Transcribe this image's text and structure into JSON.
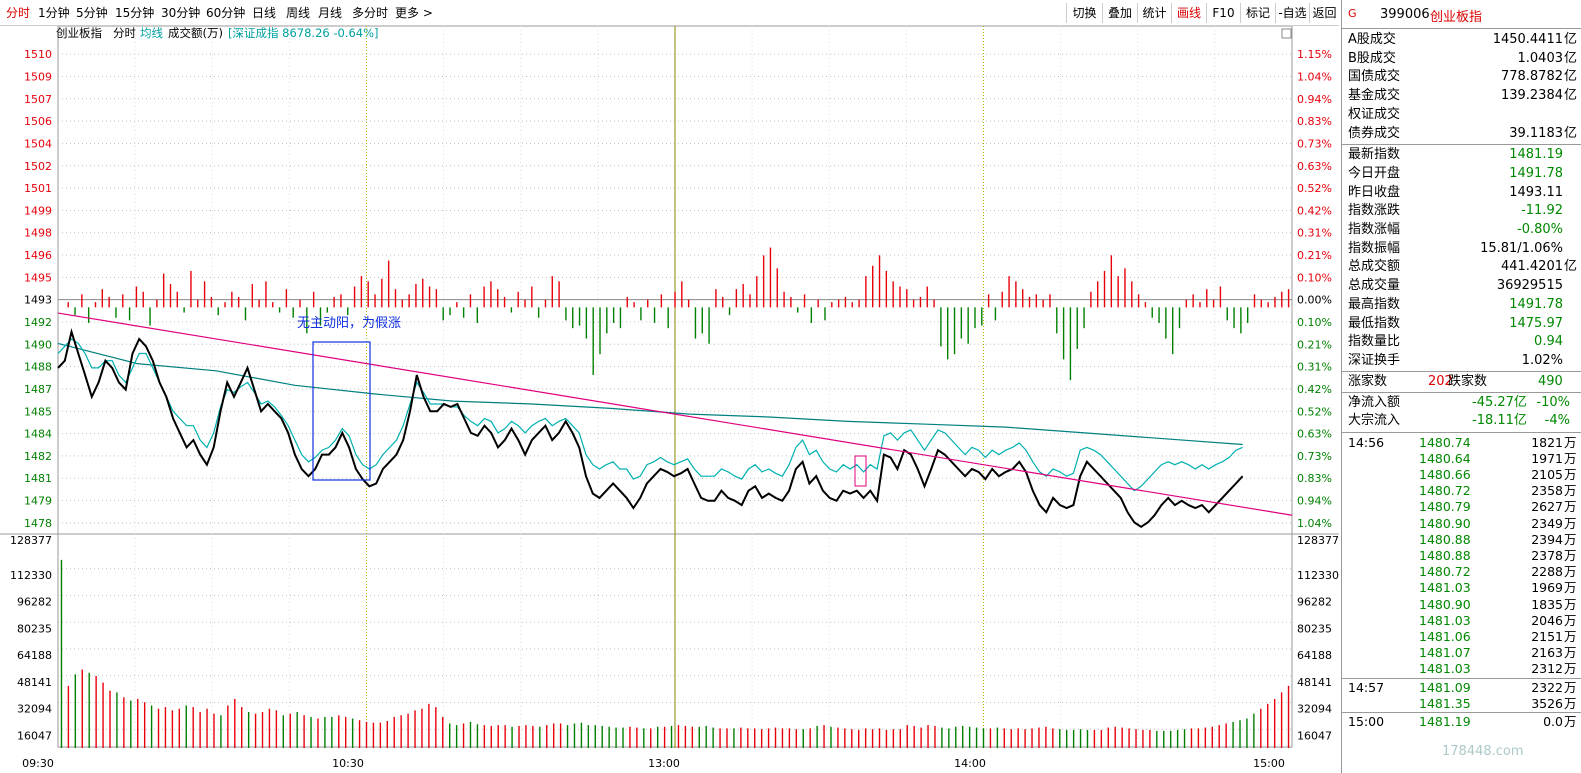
{
  "toolbar": {
    "periods": [
      "分时",
      "1分钟",
      "5分钟",
      "15分钟",
      "30分钟",
      "60分钟",
      "日线",
      "周线",
      "月线",
      "多分时",
      "更多 >"
    ],
    "actions": [
      "切换",
      "叠加",
      "统计",
      "画线",
      "F10",
      "标记",
      "-自选",
      "返回"
    ]
  },
  "chart": {
    "header": {
      "name": "创业板指",
      "mode": "分时",
      "avg": "均线",
      "vol": "成交额(万)",
      "ref": "[深证成指 8678.26 -0.64%]"
    },
    "annotation": "无主动阳，为假涨",
    "price_labels": [
      "1510",
      "1509",
      "1507",
      "1506",
      "1504",
      "1502",
      "1501",
      "1499",
      "1498",
      "1496",
      "1495",
      "1493",
      "1492",
      "1490",
      "1488",
      "1487",
      "1485",
      "1484",
      "1482",
      "1481",
      "1479",
      "1478"
    ],
    "pct_labels": [
      "1.15%",
      "1.04%",
      "0.94%",
      "0.83%",
      "0.73%",
      "0.63%",
      "0.52%",
      "0.42%",
      "0.31%",
      "0.21%",
      "0.10%",
      "0.00%",
      "0.10%",
      "0.21%",
      "0.31%",
      "0.42%",
      "0.52%",
      "0.63%",
      "0.73%",
      "0.83%",
      "0.94%",
      "1.04%"
    ],
    "vol_labels": [
      "128377",
      "112330",
      "96282",
      "80235",
      "64188",
      "48141",
      "32094",
      "16047"
    ],
    "time_labels": [
      "09:30",
      "10:30",
      "13:00",
      "14:00",
      "15:00"
    ],
    "colors": {
      "up": "#e8000b",
      "down": "#008000",
      "price": "#000000",
      "avg": "#00b0b0",
      "ma": "#008080",
      "trend": "#e0007f",
      "box": "#1030e0",
      "grid": "#bfbfbf",
      "vgrid": "#8a8a00"
    }
  },
  "chart_data": {
    "type": "line",
    "title": "创业板指 分时",
    "prev_close": 1493.11,
    "ylim": [
      1477,
      1511
    ],
    "price": [
      1488.5,
      1489,
      1491,
      1489.5,
      1488.0,
      1486.5,
      1487.5,
      1489.0,
      1488.5,
      1487.5,
      1487.0,
      1489.5,
      1490.5,
      1490.0,
      1489.0,
      1487.5,
      1486.5,
      1485.0,
      1484.0,
      1483.0,
      1483.5,
      1482.5,
      1481.8,
      1483.0,
      1485.5,
      1487.5,
      1486.5,
      1487.5,
      1488.5,
      1487.0,
      1485.5,
      1486.0,
      1485.5,
      1485.0,
      1484.0,
      1482.5,
      1481.5,
      1481.0,
      1481.5,
      1482.5,
      1482.5,
      1483.0,
      1484.0,
      1483.0,
      1481.5,
      1480.8,
      1480.3,
      1480.5,
      1481.5,
      1482.0,
      1482.5,
      1483.5,
      1485.5,
      1488.0,
      1486.5,
      1485.5,
      1485.5,
      1486.0,
      1485.8,
      1486.0,
      1485.0,
      1484.0,
      1483.8,
      1484.5,
      1484.0,
      1483.0,
      1483.5,
      1484.3,
      1483.5,
      1482.5,
      1483.5,
      1484.0,
      1484.5,
      1483.5,
      1484.0,
      1484.8,
      1484.0,
      1483.0,
      1481.0,
      1479.8,
      1479.5,
      1480.0,
      1480.5,
      1480.0,
      1479.5,
      1478.8,
      1479.5,
      1480.5,
      1481.0,
      1481.5,
      1481.3,
      1481.0,
      1481.2,
      1481.5,
      1480.5,
      1479.5,
      1479.3,
      1479.3,
      1480.0,
      1479.5,
      1479.3,
      1479.0,
      1480.0,
      1480.3,
      1479.5,
      1479.8,
      1479.5,
      1479.3,
      1480.0,
      1481.5,
      1482.0,
      1480.5,
      1481.0,
      1480.0,
      1479.5,
      1479.3,
      1480.0,
      1479.8,
      1480.0,
      1479.5,
      1480.0,
      1479.3,
      1482.5,
      1482.3,
      1481.5,
      1482.8,
      1482.5,
      1481.5,
      1480.3,
      1481.5,
      1482.8,
      1482.5,
      1482.0,
      1481.5,
      1481.0,
      1481.5,
      1481.3,
      1480.8,
      1481.5,
      1481.0,
      1481.3,
      1481.5,
      1482.0,
      1481.3,
      1480.0,
      1479.0,
      1478.5,
      1479.5,
      1479.0,
      1478.8,
      1479.0,
      1481.0,
      1482.0,
      1481.5,
      1481.0,
      1480.5,
      1480.0,
      1479.5,
      1478.5,
      1477.8,
      1477.5,
      1477.8,
      1478.3,
      1479.0,
      1479.5,
      1479.0,
      1479.3,
      1479.0,
      1478.8,
      1479.0,
      1478.5,
      1479.0,
      1479.5,
      1480.0,
      1480.5,
      1481.0
    ],
    "avg": [
      1489.5,
      1490,
      1490.5,
      1490.2,
      1489.5,
      1488.5,
      1488.5,
      1489.0,
      1489.0,
      1488.0,
      1487.5,
      1488.5,
      1489.5,
      1489.5,
      1488.5,
      1487.5,
      1486.5,
      1485.5,
      1485.0,
      1484.5,
      1484.5,
      1483.5,
      1483.0,
      1484.0,
      1485.8,
      1487.0,
      1486.8,
      1487.2,
      1487.5,
      1486.8,
      1486.0,
      1486.2,
      1485.8,
      1485.2,
      1484.5,
      1483.5,
      1482.5,
      1482.0,
      1482.3,
      1482.8,
      1483.0,
      1483.5,
      1484.3,
      1483.8,
      1482.5,
      1481.8,
      1481.5,
      1481.8,
      1482.5,
      1483.0,
      1483.5,
      1484.5,
      1486.0,
      1487.5,
      1486.8,
      1486.0,
      1486.0,
      1486.0,
      1485.8,
      1485.8,
      1485.2,
      1484.8,
      1484.5,
      1485.0,
      1484.8,
      1484.0,
      1484.3,
      1484.8,
      1484.5,
      1484.0,
      1484.5,
      1484.8,
      1485.0,
      1484.5,
      1484.8,
      1485.0,
      1484.5,
      1484.0,
      1482.5,
      1481.8,
      1481.5,
      1481.8,
      1482.0,
      1481.5,
      1481.5,
      1480.8,
      1481.0,
      1481.8,
      1482.0,
      1482.3,
      1482.0,
      1481.8,
      1482.0,
      1482.2,
      1481.5,
      1481.0,
      1481.0,
      1481.0,
      1481.5,
      1481.3,
      1481.0,
      1480.8,
      1481.5,
      1481.8,
      1481.3,
      1481.5,
      1481.2,
      1481.0,
      1481.8,
      1483.0,
      1483.5,
      1482.5,
      1482.8,
      1482.0,
      1481.5,
      1481.3,
      1481.8,
      1481.5,
      1481.8,
      1481.3,
      1481.8,
      1481.5,
      1483.8,
      1484.0,
      1483.5,
      1484.0,
      1484.2,
      1483.5,
      1482.8,
      1483.5,
      1484.2,
      1484.0,
      1483.5,
      1483.0,
      1482.5,
      1483.0,
      1482.8,
      1482.3,
      1482.8,
      1482.5,
      1482.8,
      1483.0,
      1483.3,
      1482.8,
      1482.0,
      1481.3,
      1481.0,
      1481.5,
      1481.3,
      1481.0,
      1481.2,
      1482.8,
      1483.0,
      1482.8,
      1482.5,
      1482.0,
      1481.5,
      1481.0,
      1480.5,
      1480.0,
      1480.3,
      1480.8,
      1481.3,
      1481.8,
      1482.0,
      1481.8,
      1482.0,
      1481.8,
      1481.5,
      1481.8,
      1481.5,
      1481.8,
      1482.0,
      1482.3,
      1482.8,
      1483.0
    ],
    "ma": [
      1490.2,
      1488.8,
      1488.3,
      1487.3,
      1486.7,
      1486.2,
      1486.0,
      1485.7,
      1485.3,
      1485.1,
      1484.8,
      1484.6,
      1484.4,
      1484.0,
      1483.6,
      1483.2
    ],
    "trend_line": {
      "from": [
        1492.3,
        0
      ],
      "to": [
        1478.3,
        1
      ]
    },
    "pct_bars": [
      0,
      0.02,
      -0.03,
      0.05,
      -0.06,
      0.02,
      0.07,
      0.04,
      -0.04,
      0.05,
      -0.05,
      0.08,
      0.06,
      -0.07,
      0.03,
      0.13,
      0.09,
      0.06,
      -0.02,
      0.14,
      0.03,
      0.1,
      0.04,
      -0.03,
      0.02,
      0.06,
      0.04,
      -0.05,
      0.09,
      0.03,
      0.1,
      0.02,
      -0.02,
      0.07,
      -0.04,
      0.03,
      -0.1,
      0.06,
      -0.07,
      -0.02,
      0.04,
      0.05,
      -0.03,
      0.08,
      0.12,
      0.1,
      0.05,
      0.11,
      0.18,
      0.07,
      0.03,
      0.05,
      0.09,
      0.11,
      0.08,
      0.07,
      -0.05,
      -0.03,
      0.02,
      -0.04,
      0.05,
      -0.06,
      0.08,
      0.1,
      0.07,
      0.04,
      -0.02,
      0.06,
      0.03,
      0.08,
      -0.04,
      0.03,
      0.12,
      0.1,
      -0.05,
      -0.08,
      -0.07,
      -0.12,
      -0.26,
      -0.18,
      -0.1,
      -0.06,
      -0.08,
      0.04,
      0.02,
      -0.05,
      0.03,
      -0.06,
      0.05,
      -0.08,
      0.06,
      0.1,
      0.03,
      -0.12,
      -0.1,
      -0.14,
      0.07,
      0.04,
      -0.03,
      0.07,
      0.09,
      0.05,
      0.12,
      0.2,
      0.23,
      0.15,
      0.06,
      0.04,
      -0.02,
      0.05,
      -0.06,
      0.03,
      -0.05,
      0.02,
      0.03,
      0.04,
      0.02,
      0.03,
      0.12,
      0.16,
      0.2,
      0.14,
      0.1,
      0.08,
      0.07,
      0.03,
      0.04,
      0.08,
      0.03,
      -0.15,
      -0.2,
      -0.18,
      -0.12,
      -0.14,
      -0.08,
      -0.07,
      0.05,
      -0.05,
      0.06,
      0.12,
      0.1,
      0.07,
      0.04,
      0.05,
      0.03,
      0.05,
      -0.1,
      -0.2,
      -0.28,
      -0.16,
      -0.08,
      0.06,
      0.1,
      0.14,
      0.2,
      0.12,
      0.15,
      0.1,
      0.05,
      0.02,
      -0.04,
      -0.06,
      -0.12,
      -0.18,
      -0.08,
      0.03,
      0.05,
      0.02,
      0.07,
      0.03,
      0.08,
      -0.05,
      -0.08,
      -0.1,
      -0.06,
      0.05,
      0.03,
      0.02,
      0.04,
      0.06,
      0.07
    ],
    "volume": [
      115000,
      38000,
      45000,
      48000,
      46000,
      44000,
      40000,
      35000,
      34000,
      31000,
      29000,
      30000,
      28000,
      26000,
      24000,
      25000,
      23000,
      24000,
      26000,
      25000,
      22000,
      24000,
      21000,
      20000,
      26000,
      30000,
      25000,
      22000,
      21000,
      22000,
      24000,
      23000,
      20000,
      21000,
      22000,
      20000,
      19000,
      18000,
      19000,
      19000,
      20000,
      19000,
      18000,
      17000,
      16000,
      15500,
      15500,
      16500,
      19000,
      20000,
      21000,
      23000,
      24000,
      27000,
      25000,
      19000,
      15000,
      14000,
      15000,
      16000,
      14500,
      14000,
      13500,
      14000,
      14000,
      13000,
      13500,
      14000,
      13500,
      13000,
      14000,
      15000,
      15000,
      14000,
      15000,
      15500,
      14000,
      14000,
      13500,
      13000,
      12500,
      12500,
      13000,
      12500,
      12000,
      12000,
      13000,
      13000,
      13500,
      14000,
      13500,
      13000,
      13000,
      13500,
      12500,
      12000,
      12000,
      12000,
      12500,
      12000,
      12000,
      11500,
      12000,
      12500,
      12000,
      12000,
      11500,
      11500,
      12000,
      13500,
      14000,
      13000,
      12500,
      12000,
      11500,
      11000,
      12000,
      11500,
      12000,
      11000,
      11500,
      11500,
      14000,
      13500,
      12500,
      14000,
      13500,
      12500,
      12000,
      13000,
      13500,
      13000,
      12500,
      12000,
      12000,
      12500,
      12000,
      11500,
      12000,
      11500,
      12000,
      12500,
      13000,
      12000,
      11500,
      11000,
      11000,
      11500,
      11000,
      11000,
      11000,
      12500,
      13000,
      12500,
      12000,
      11500,
      11000,
      11000,
      10500,
      10500,
      10500,
      11000,
      11500,
      12000,
      12000,
      12500,
      13000,
      14000,
      15000,
      16000,
      17000,
      18000,
      21000,
      24000,
      27000,
      30000,
      34000,
      38000
    ]
  },
  "side": {
    "code": "399006",
    "name": "创业板指",
    "g": "G",
    "block1": [
      {
        "l": "A股成交",
        "v": "1450.4411",
        "u": "亿"
      },
      {
        "l": "B股成交",
        "v": "1.0403",
        "u": "亿"
      },
      {
        "l": "国债成交",
        "v": "778.8782",
        "u": "亿"
      },
      {
        "l": "基金成交",
        "v": "139.2384",
        "u": "亿"
      },
      {
        "l": "权证成交",
        "v": "",
        "u": ""
      },
      {
        "l": "债券成交",
        "v": "39.1183",
        "u": "亿"
      }
    ],
    "block2": [
      {
        "l": "最新指数",
        "v": "1481.19",
        "c": "grn"
      },
      {
        "l": "今日开盘",
        "v": "1491.78",
        "c": "grn"
      },
      {
        "l": "昨日收盘",
        "v": "1493.11",
        "c": "blk"
      },
      {
        "l": "指数涨跌",
        "v": "-11.92",
        "c": "grn"
      },
      {
        "l": "指数涨幅",
        "v": "-0.80%",
        "c": "grn"
      },
      {
        "l": "指数振幅",
        "v": "15.81/1.06%",
        "c": "blk"
      },
      {
        "l": "总成交额",
        "v": "441.4201",
        "u": "亿",
        "c": "blk"
      },
      {
        "l": "总成交量",
        "v": "36929515",
        "c": "blk"
      },
      {
        "l": "最高指数",
        "v": "1491.78",
        "c": "grn"
      },
      {
        "l": "最低指数",
        "v": "1475.97",
        "c": "grn"
      },
      {
        "l": "指数量比",
        "v": "0.94",
        "c": "grn"
      },
      {
        "l": "深证换手",
        "v": "1.02%",
        "c": "blk"
      }
    ],
    "updown": {
      "up_label": "涨家数",
      "up": "202",
      "down_label": "跌家数",
      "down": "490"
    },
    "flow": [
      {
        "l": "净流入额",
        "v": "-45.27亿",
        "p": "-10%"
      },
      {
        "l": "大宗流入",
        "v": "-18.11亿",
        "p": "-4%"
      }
    ],
    "ticks": [
      {
        "t": "14:56",
        "p": "1480.74",
        "v": "1821"
      },
      {
        "t": "",
        "p": "1480.64",
        "v": "1971"
      },
      {
        "t": "",
        "p": "1480.66",
        "v": "2105"
      },
      {
        "t": "",
        "p": "1480.72",
        "v": "2358"
      },
      {
        "t": "",
        "p": "1480.79",
        "v": "2627"
      },
      {
        "t": "",
        "p": "1480.90",
        "v": "2349"
      },
      {
        "t": "",
        "p": "1480.88",
        "v": "2394"
      },
      {
        "t": "",
        "p": "1480.88",
        "v": "2378"
      },
      {
        "t": "",
        "p": "1480.72",
        "v": "2288"
      },
      {
        "t": "",
        "p": "1481.03",
        "v": "1969"
      },
      {
        "t": "",
        "p": "1480.90",
        "v": "1835"
      },
      {
        "t": "",
        "p": "1481.03",
        "v": "2046"
      },
      {
        "t": "",
        "p": "1481.06",
        "v": "2151"
      },
      {
        "t": "",
        "p": "1481.07",
        "v": "2163"
      },
      {
        "t": "",
        "p": "1481.03",
        "v": "2312"
      },
      {
        "t": "14:57",
        "p": "1481.09",
        "v": "2322"
      },
      {
        "t": "",
        "p": "1481.35",
        "v": "3526"
      },
      {
        "t": "15:00",
        "p": "1481.19",
        "v": "0.0"
      }
    ],
    "tick_unit": "万",
    "watermark": "178448.com"
  }
}
